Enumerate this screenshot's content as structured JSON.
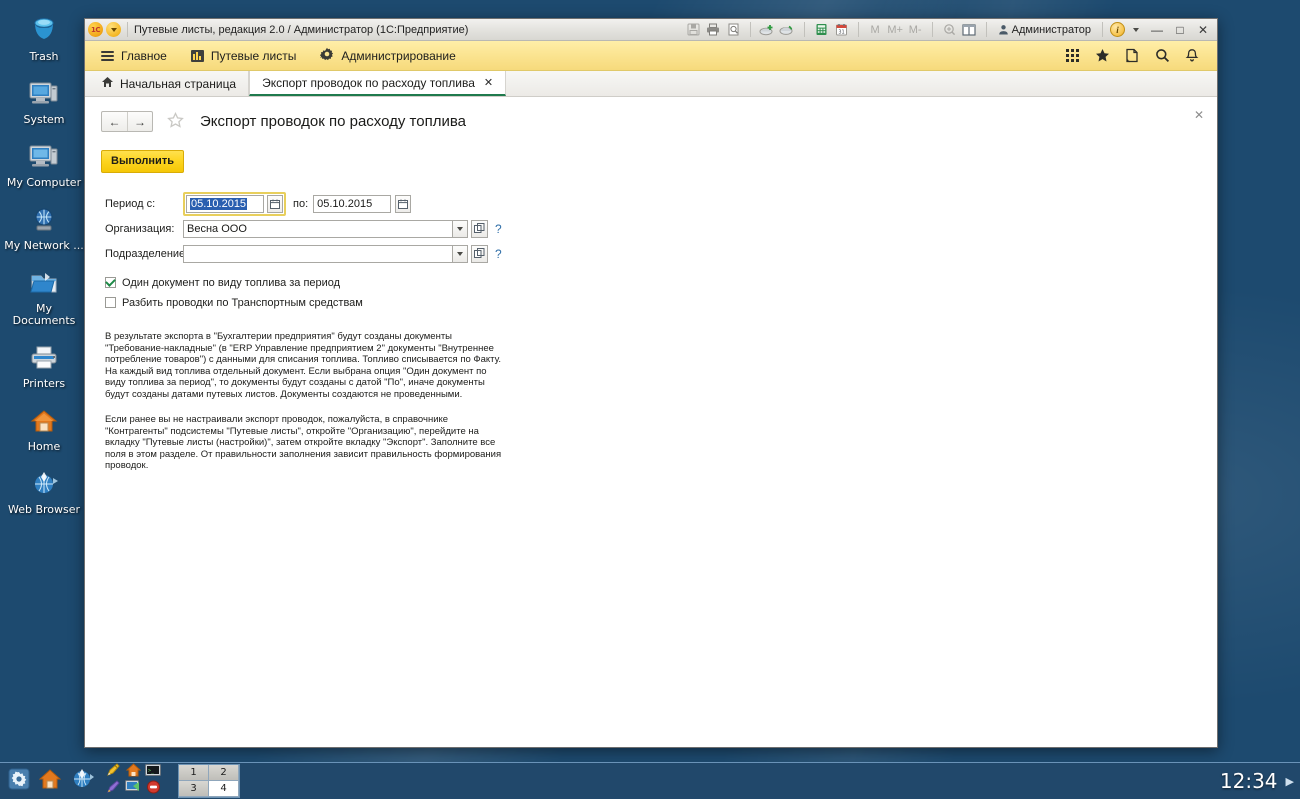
{
  "desktop": {
    "icons": [
      {
        "label": "Trash",
        "icon": "trash-bin-icon"
      },
      {
        "label": "System",
        "icon": "system-computer-icon"
      },
      {
        "label": "My Computer",
        "icon": "my-computer-icon"
      },
      {
        "label": "My Network ...",
        "icon": "network-globe-icon"
      },
      {
        "label": "My Documents",
        "icon": "documents-folder-icon"
      },
      {
        "label": "Printers",
        "icon": "printer-icon"
      },
      {
        "label": "Home",
        "icon": "home-house-icon"
      },
      {
        "label": "Web Browser",
        "icon": "web-browser-icon"
      }
    ]
  },
  "window": {
    "title": "Путевые листы, редакция 2.0 / Администратор  (1С:Предприятие)",
    "logo_text": "1C",
    "user": "Администратор",
    "toolbar_memory": {
      "m": "M",
      "m_plus": "M+",
      "m_minus": "M-"
    },
    "controls": {
      "minimize": "—",
      "maximize": "□",
      "close": "✕"
    }
  },
  "menubar": {
    "items": [
      {
        "label": "Главное",
        "icon": "burger-menu-icon"
      },
      {
        "label": "Путевые листы",
        "icon": "waybill-doc-icon"
      },
      {
        "label": "Администрирование",
        "icon": "gear-icon"
      }
    ],
    "right_icons": [
      {
        "icon": "apps-grid-icon"
      },
      {
        "icon": "star-favorites-icon"
      },
      {
        "icon": "history-page-icon"
      },
      {
        "icon": "search-icon"
      },
      {
        "icon": "bell-notifications-icon"
      }
    ]
  },
  "tabs": [
    {
      "label": "Начальная страница",
      "icon": "home-icon",
      "active": false,
      "closable": false
    },
    {
      "label": "Экспорт проводок по расходу топлива",
      "active": true,
      "closable": true,
      "close_glyph": "✕"
    }
  ],
  "form": {
    "close_glyph": "✕",
    "nav": {
      "back": "←",
      "forward": "→"
    },
    "favorite_icon": "star-outline-icon",
    "title": "Экспорт проводок по расходу топлива",
    "execute_button": "Выполнить",
    "fields": {
      "period_label": "Период с:",
      "period_from": "05.10.2015",
      "period_to_label": "по:",
      "period_to": "05.10.2015",
      "organization_label": "Организация:",
      "organization_value": "Весна ООО",
      "division_label": "Подразделение:",
      "division_value": "",
      "help_glyph": "?"
    },
    "checkboxes": [
      {
        "label": "Один документ по виду топлива за период",
        "checked": true
      },
      {
        "label": "Разбить проводки по Транспортным средствам",
        "checked": false
      }
    ],
    "notes": [
      "В результате экспорта в \"Бухгалтерии предприятия\" будут созданы документы \"Требование-накладные\" (в \"ERP Управление предприятием 2\" документы \"Внутреннее потребление товаров\") с данными для списания топлива. Топливо списывается по Факту. На каждый вид топлива отдельный документ. Если выбрана опция \"Один документ по виду топлива за период\", то документы будут созданы с датой \"По\", иначе документы будут созданы датами путевых листов. Документы создаются не проведенными.",
      "Если ранее вы не настраивали экспорт проводок, пожалуйста, в справочнике \"Контрагенты\" подсистемы \"Путевые листы\", откройте \"Организацию\", перейдите на вкладку \"Путевые листы (настройки)\", затем откройте вкладку \"Экспорт\". Заполните все поля в этом разделе. От правильности заполнения зависит правильность формирования проводок."
    ]
  },
  "taskbar": {
    "workspaces": [
      {
        "label": "1",
        "active": false
      },
      {
        "label": "2",
        "active": false
      },
      {
        "label": "3",
        "active": false
      },
      {
        "label": "4",
        "active": true
      }
    ],
    "clock": "12:34",
    "tray_arrow": "▶"
  },
  "colors": {
    "menubar_yellow": "#fbe491",
    "accent_green": "#1f7a4d",
    "exec_button": "#fdd520",
    "focus_border": "#e8cf5c",
    "selection_blue": "#2a5fb0",
    "help_link": "#2f6ea8",
    "desktop_blue": "#21486b"
  }
}
